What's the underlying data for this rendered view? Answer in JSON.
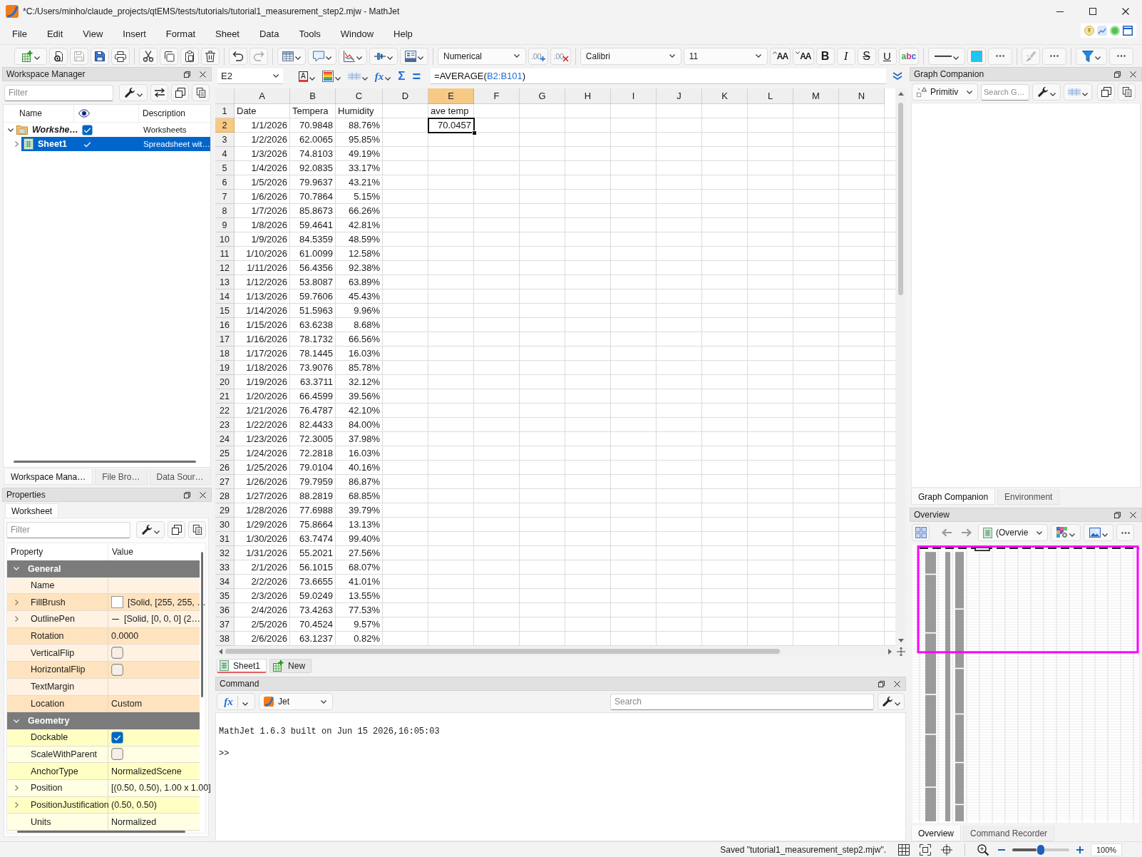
{
  "window": {
    "title": "*C:/Users/minho/claude_projects/qtEMS/tests/tutorials/tutorial1_measurement_step2.mjw - MathJet"
  },
  "menu": [
    "File",
    "Edit",
    "View",
    "Insert",
    "Format",
    "Sheet",
    "Data",
    "Tools",
    "Window",
    "Help"
  ],
  "toolbar": {
    "groups": [
      [
        {
          "kind": "new_sheet",
          "disabled": false
        },
        {
          "kind": "open",
          "disabled": false
        },
        {
          "kind": "save",
          "disabled": true
        },
        {
          "kind": "save_all",
          "disabled": false
        },
        {
          "kind": "print",
          "disabled": false
        }
      ],
      [
        {
          "kind": "cut",
          "disabled": false
        },
        {
          "kind": "copy",
          "disabled": false
        },
        {
          "kind": "paste",
          "disabled": false
        },
        {
          "kind": "delete",
          "disabled": false
        }
      ],
      [
        {
          "kind": "undo",
          "disabled": false
        },
        {
          "kind": "redo",
          "disabled": true
        }
      ],
      [
        {
          "kind": "insert_table",
          "disabled": false
        },
        {
          "kind": "insert_comment",
          "disabled": false
        },
        {
          "kind": "insert_chart",
          "disabled": false
        },
        {
          "kind": "insert_slider",
          "disabled": false
        },
        {
          "kind": "insert_form",
          "disabled": false
        }
      ],
      [
        {
          "kind": "number_format",
          "value": "Numerical",
          "disabled": false
        },
        {
          "kind": "increase_decimals",
          "glyph": ".00",
          "disabled": false
        },
        {
          "kind": "decrease_decimals",
          "glyph": ".00",
          "disabled": false
        }
      ],
      [
        {
          "kind": "font",
          "value": "Calibri",
          "disabled": false
        },
        {
          "kind": "font_size",
          "value": "11",
          "disabled": false
        },
        {
          "kind": "grow_font",
          "glyph": "AA",
          "disabled": false
        },
        {
          "kind": "shrink_font",
          "glyph": "AA",
          "disabled": false
        },
        {
          "kind": "bold",
          "glyph": "B",
          "disabled": false
        },
        {
          "kind": "italic",
          "glyph": "I",
          "disabled": false
        },
        {
          "kind": "strikeout",
          "glyph": "S",
          "disabled": false
        },
        {
          "kind": "underline",
          "glyph": "U",
          "disabled": false
        },
        {
          "kind": "spelling",
          "glyph": "abc",
          "disabled": false
        }
      ],
      [
        {
          "kind": "line_style",
          "disabled": false
        },
        {
          "kind": "line_color",
          "color": "#22c4f2",
          "disabled": false
        },
        {
          "kind": "more",
          "disabled": false
        }
      ],
      [
        {
          "kind": "brush",
          "disabled": true
        },
        {
          "kind": "more",
          "disabled": false
        }
      ],
      [
        {
          "kind": "filter",
          "disabled": false
        },
        {
          "kind": "more",
          "disabled": false
        }
      ]
    ]
  },
  "workspace_manager": {
    "title": "Workspace Manager",
    "filter_placeholder": "Filter",
    "name_column": "Name",
    "description_column": "Description",
    "tree": [
      {
        "name": "Workshe…",
        "kind": "folder",
        "expanded": true,
        "selected": false,
        "visible": true,
        "description": "Worksheets",
        "children": [
          {
            "name": "Sheet1",
            "kind": "sheet",
            "expanded": false,
            "selected": true,
            "visible": true,
            "description": "Spreadsheet wit…"
          }
        ]
      }
    ],
    "tabs": [
      {
        "label": "Workspace Mana…",
        "selected": true
      },
      {
        "label": "File Bro…",
        "selected": false
      },
      {
        "label": "Data Sour…",
        "selected": false
      }
    ]
  },
  "properties": {
    "title": "Properties",
    "tabs": [
      {
        "label": "Worksheet",
        "selected": true
      }
    ],
    "filter_placeholder": "Filter",
    "property_column": "Property",
    "value_column": "Value",
    "groups": [
      {
        "name": "General",
        "expanded": true,
        "color": "#ffe3bf",
        "rows": [
          {
            "name": "Name",
            "kind": "text",
            "expandable": false
          },
          {
            "name": "FillBrush",
            "kind": "brush",
            "expandable": true,
            "color": "#ffffff",
            "value": "[Solid, [255, 255, …"
          },
          {
            "name": "OutlinePen",
            "kind": "pen",
            "expandable": true,
            "value": "[Solid, [0, 0, 0] (2…"
          },
          {
            "name": "Rotation",
            "kind": "text",
            "expandable": false,
            "value": "0.0000"
          },
          {
            "name": "VerticalFlip",
            "kind": "checkbox",
            "expandable": false,
            "checked": false
          },
          {
            "name": "HorizontalFlip",
            "kind": "checkbox",
            "expandable": false,
            "checked": false
          },
          {
            "name": "TextMargin",
            "kind": "text",
            "expandable": false
          },
          {
            "name": "Location",
            "kind": "text",
            "expandable": false,
            "value": "Custom"
          }
        ]
      },
      {
        "name": "Geometry",
        "expanded": true,
        "color": "#ffffc4",
        "rows": [
          {
            "name": "Dockable",
            "kind": "checkbox",
            "expandable": false,
            "checked": true
          },
          {
            "name": "ScaleWithParent",
            "kind": "checkbox",
            "expandable": false,
            "checked": false
          },
          {
            "name": "AnchorType",
            "kind": "text",
            "expandable": false,
            "value": "NormalizedScene"
          },
          {
            "name": "Position",
            "kind": "text",
            "expandable": true,
            "value": "[(0.50, 0.50), 1.00 x 1.00]"
          },
          {
            "name": "PositionJustification",
            "kind": "text",
            "expandable": true,
            "value": "(0.50, 0.50)"
          },
          {
            "name": "Units",
            "kind": "text",
            "expandable": false,
            "value": "Normalized"
          }
        ]
      }
    ]
  },
  "formula_bar": {
    "name_box": "E2",
    "tools": [
      {
        "kind": "font_color",
        "glyph": "A"
      },
      {
        "kind": "fill_color"
      },
      {
        "kind": "borders"
      },
      {
        "kind": "function",
        "glyph": "fx"
      },
      {
        "kind": "sum",
        "glyph": "Σ"
      },
      {
        "kind": "equals",
        "glyph": "="
      }
    ],
    "formula": [
      {
        "kind": "text",
        "text": "=AVERAGE("
      },
      {
        "kind": "reference",
        "text": "B2:B101"
      },
      {
        "kind": "text",
        "text": ")"
      }
    ]
  },
  "spreadsheet": {
    "columns": [
      {
        "label": "A",
        "selected": false
      },
      {
        "label": "B",
        "selected": false
      },
      {
        "label": "C",
        "selected": false
      },
      {
        "label": "D",
        "selected": false
      },
      {
        "label": "E",
        "selected": true
      },
      {
        "label": "F",
        "selected": false
      },
      {
        "label": "G",
        "selected": false
      },
      {
        "label": "H",
        "selected": false
      },
      {
        "label": "I",
        "selected": false
      },
      {
        "label": "J",
        "selected": false
      },
      {
        "label": "K",
        "selected": false
      },
      {
        "label": "L",
        "selected": false
      },
      {
        "label": "M",
        "selected": false
      },
      {
        "label": "N",
        "selected": false
      }
    ],
    "rows": [
      {
        "number": "1",
        "selected": false,
        "kind": "labels",
        "cells": [
          "Date",
          "Tempera",
          "Humidity",
          null,
          "ave temp"
        ]
      },
      {
        "number": "2",
        "selected": true,
        "kind": "values",
        "cells": [
          "1/1/2026",
          "70.9848",
          "88.76%",
          null,
          "70.0457"
        ]
      },
      {
        "number": "3",
        "selected": false,
        "kind": "values",
        "cells": [
          "1/2/2026",
          "62.0065",
          "95.85%"
        ]
      },
      {
        "number": "4",
        "selected": false,
        "kind": "values",
        "cells": [
          "1/3/2026",
          "74.8103",
          "49.19%"
        ]
      },
      {
        "number": "5",
        "selected": false,
        "kind": "values",
        "cells": [
          "1/4/2026",
          "92.0835",
          "33.17%"
        ]
      },
      {
        "number": "6",
        "selected": false,
        "kind": "values",
        "cells": [
          "1/5/2026",
          "79.9637",
          "43.21%"
        ]
      },
      {
        "number": "7",
        "selected": false,
        "kind": "values",
        "cells": [
          "1/6/2026",
          "70.7864",
          "5.15%"
        ]
      },
      {
        "number": "8",
        "selected": false,
        "kind": "values",
        "cells": [
          "1/7/2026",
          "85.8673",
          "66.26%"
        ]
      },
      {
        "number": "9",
        "selected": false,
        "kind": "values",
        "cells": [
          "1/8/2026",
          "59.4641",
          "42.81%"
        ]
      },
      {
        "number": "10",
        "selected": false,
        "kind": "values",
        "cells": [
          "1/9/2026",
          "84.5359",
          "48.59%"
        ]
      },
      {
        "number": "11",
        "selected": false,
        "kind": "values",
        "cells": [
          "1/10/2026",
          "61.0099",
          "12.58%"
        ]
      },
      {
        "number": "12",
        "selected": false,
        "kind": "values",
        "cells": [
          "1/11/2026",
          "56.4356",
          "92.38%"
        ]
      },
      {
        "number": "13",
        "selected": false,
        "kind": "values",
        "cells": [
          "1/12/2026",
          "53.8087",
          "63.89%"
        ]
      },
      {
        "number": "14",
        "selected": false,
        "kind": "values",
        "cells": [
          "1/13/2026",
          "59.7606",
          "45.43%"
        ]
      },
      {
        "number": "15",
        "selected": false,
        "kind": "values",
        "cells": [
          "1/14/2026",
          "51.5963",
          "9.96%"
        ]
      },
      {
        "number": "16",
        "selected": false,
        "kind": "values",
        "cells": [
          "1/15/2026",
          "63.6238",
          "8.68%"
        ]
      },
      {
        "number": "17",
        "selected": false,
        "kind": "values",
        "cells": [
          "1/16/2026",
          "78.1732",
          "66.56%"
        ]
      },
      {
        "number": "18",
        "selected": false,
        "kind": "values",
        "cells": [
          "1/17/2026",
          "78.1445",
          "16.03%"
        ]
      },
      {
        "number": "19",
        "selected": false,
        "kind": "values",
        "cells": [
          "1/18/2026",
          "73.9076",
          "85.78%"
        ]
      },
      {
        "number": "20",
        "selected": false,
        "kind": "values",
        "cells": [
          "1/19/2026",
          "63.3711",
          "32.12%"
        ]
      },
      {
        "number": "21",
        "selected": false,
        "kind": "values",
        "cells": [
          "1/20/2026",
          "66.4599",
          "39.56%"
        ]
      },
      {
        "number": "22",
        "selected": false,
        "kind": "values",
        "cells": [
          "1/21/2026",
          "76.4787",
          "42.10%"
        ]
      },
      {
        "number": "23",
        "selected": false,
        "kind": "values",
        "cells": [
          "1/22/2026",
          "82.4433",
          "84.00%"
        ]
      },
      {
        "number": "24",
        "selected": false,
        "kind": "values",
        "cells": [
          "1/23/2026",
          "72.3005",
          "37.98%"
        ]
      },
      {
        "number": "25",
        "selected": false,
        "kind": "values",
        "cells": [
          "1/24/2026",
          "72.2818",
          "16.03%"
        ]
      },
      {
        "number": "26",
        "selected": false,
        "kind": "values",
        "cells": [
          "1/25/2026",
          "79.0104",
          "40.16%"
        ]
      },
      {
        "number": "27",
        "selected": false,
        "kind": "values",
        "cells": [
          "1/26/2026",
          "79.7959",
          "86.87%"
        ]
      },
      {
        "number": "28",
        "selected": false,
        "kind": "values",
        "cells": [
          "1/27/2026",
          "88.2819",
          "68.85%"
        ]
      },
      {
        "number": "29",
        "selected": false,
        "kind": "values",
        "cells": [
          "1/28/2026",
          "77.6988",
          "39.79%"
        ]
      },
      {
        "number": "30",
        "selected": false,
        "kind": "values",
        "cells": [
          "1/29/2026",
          "75.8664",
          "13.13%"
        ]
      },
      {
        "number": "31",
        "selected": false,
        "kind": "values",
        "cells": [
          "1/30/2026",
          "63.7474",
          "99.40%"
        ]
      },
      {
        "number": "32",
        "selected": false,
        "kind": "values",
        "cells": [
          "1/31/2026",
          "55.2021",
          "27.56%"
        ]
      },
      {
        "number": "33",
        "selected": false,
        "kind": "values",
        "cells": [
          "2/1/2026",
          "56.1015",
          "68.07%"
        ]
      },
      {
        "number": "34",
        "selected": false,
        "kind": "values",
        "cells": [
          "2/2/2026",
          "73.6655",
          "41.01%"
        ]
      },
      {
        "number": "35",
        "selected": false,
        "kind": "values",
        "cells": [
          "2/3/2026",
          "59.0249",
          "13.55%"
        ]
      },
      {
        "number": "36",
        "selected": false,
        "kind": "values",
        "cells": [
          "2/4/2026",
          "73.4263",
          "77.53%"
        ]
      },
      {
        "number": "37",
        "selected": false,
        "kind": "values",
        "cells": [
          "2/5/2026",
          "70.4524",
          "9.57%"
        ]
      },
      {
        "number": "38",
        "selected": false,
        "kind": "values",
        "cells": [
          "2/6/2026",
          "63.1237",
          "0.82%"
        ]
      }
    ]
  },
  "sheet_tabs": [
    {
      "label": "Sheet1",
      "kind": "sheet",
      "selected": true
    },
    {
      "label": "New",
      "kind": "new",
      "selected": false
    }
  ],
  "command": {
    "title": "Command",
    "function_glyph": "fx",
    "language": "Jet",
    "search_placeholder": "Search",
    "output": [
      "MathJet 1.6.3 built on Jun 15 2026,16:05:03",
      ">>"
    ]
  },
  "graph_companion": {
    "title": "Graph Companion",
    "primitive": "Primitiv",
    "search_placeholder": "Search G…",
    "tabs": [
      {
        "label": "Graph Companion",
        "selected": true
      },
      {
        "label": "Environment",
        "selected": false
      }
    ]
  },
  "overview": {
    "title": "Overview",
    "view": "(Overvie",
    "tabs": [
      {
        "label": "Overview",
        "selected": true
      },
      {
        "label": "Command Recorder",
        "selected": false
      }
    ]
  },
  "status_bar": {
    "message": "Saved \"tutorial1_measurement_step2.mjw\".",
    "zoom": {
      "level": 0.5,
      "reading": "100%"
    }
  }
}
